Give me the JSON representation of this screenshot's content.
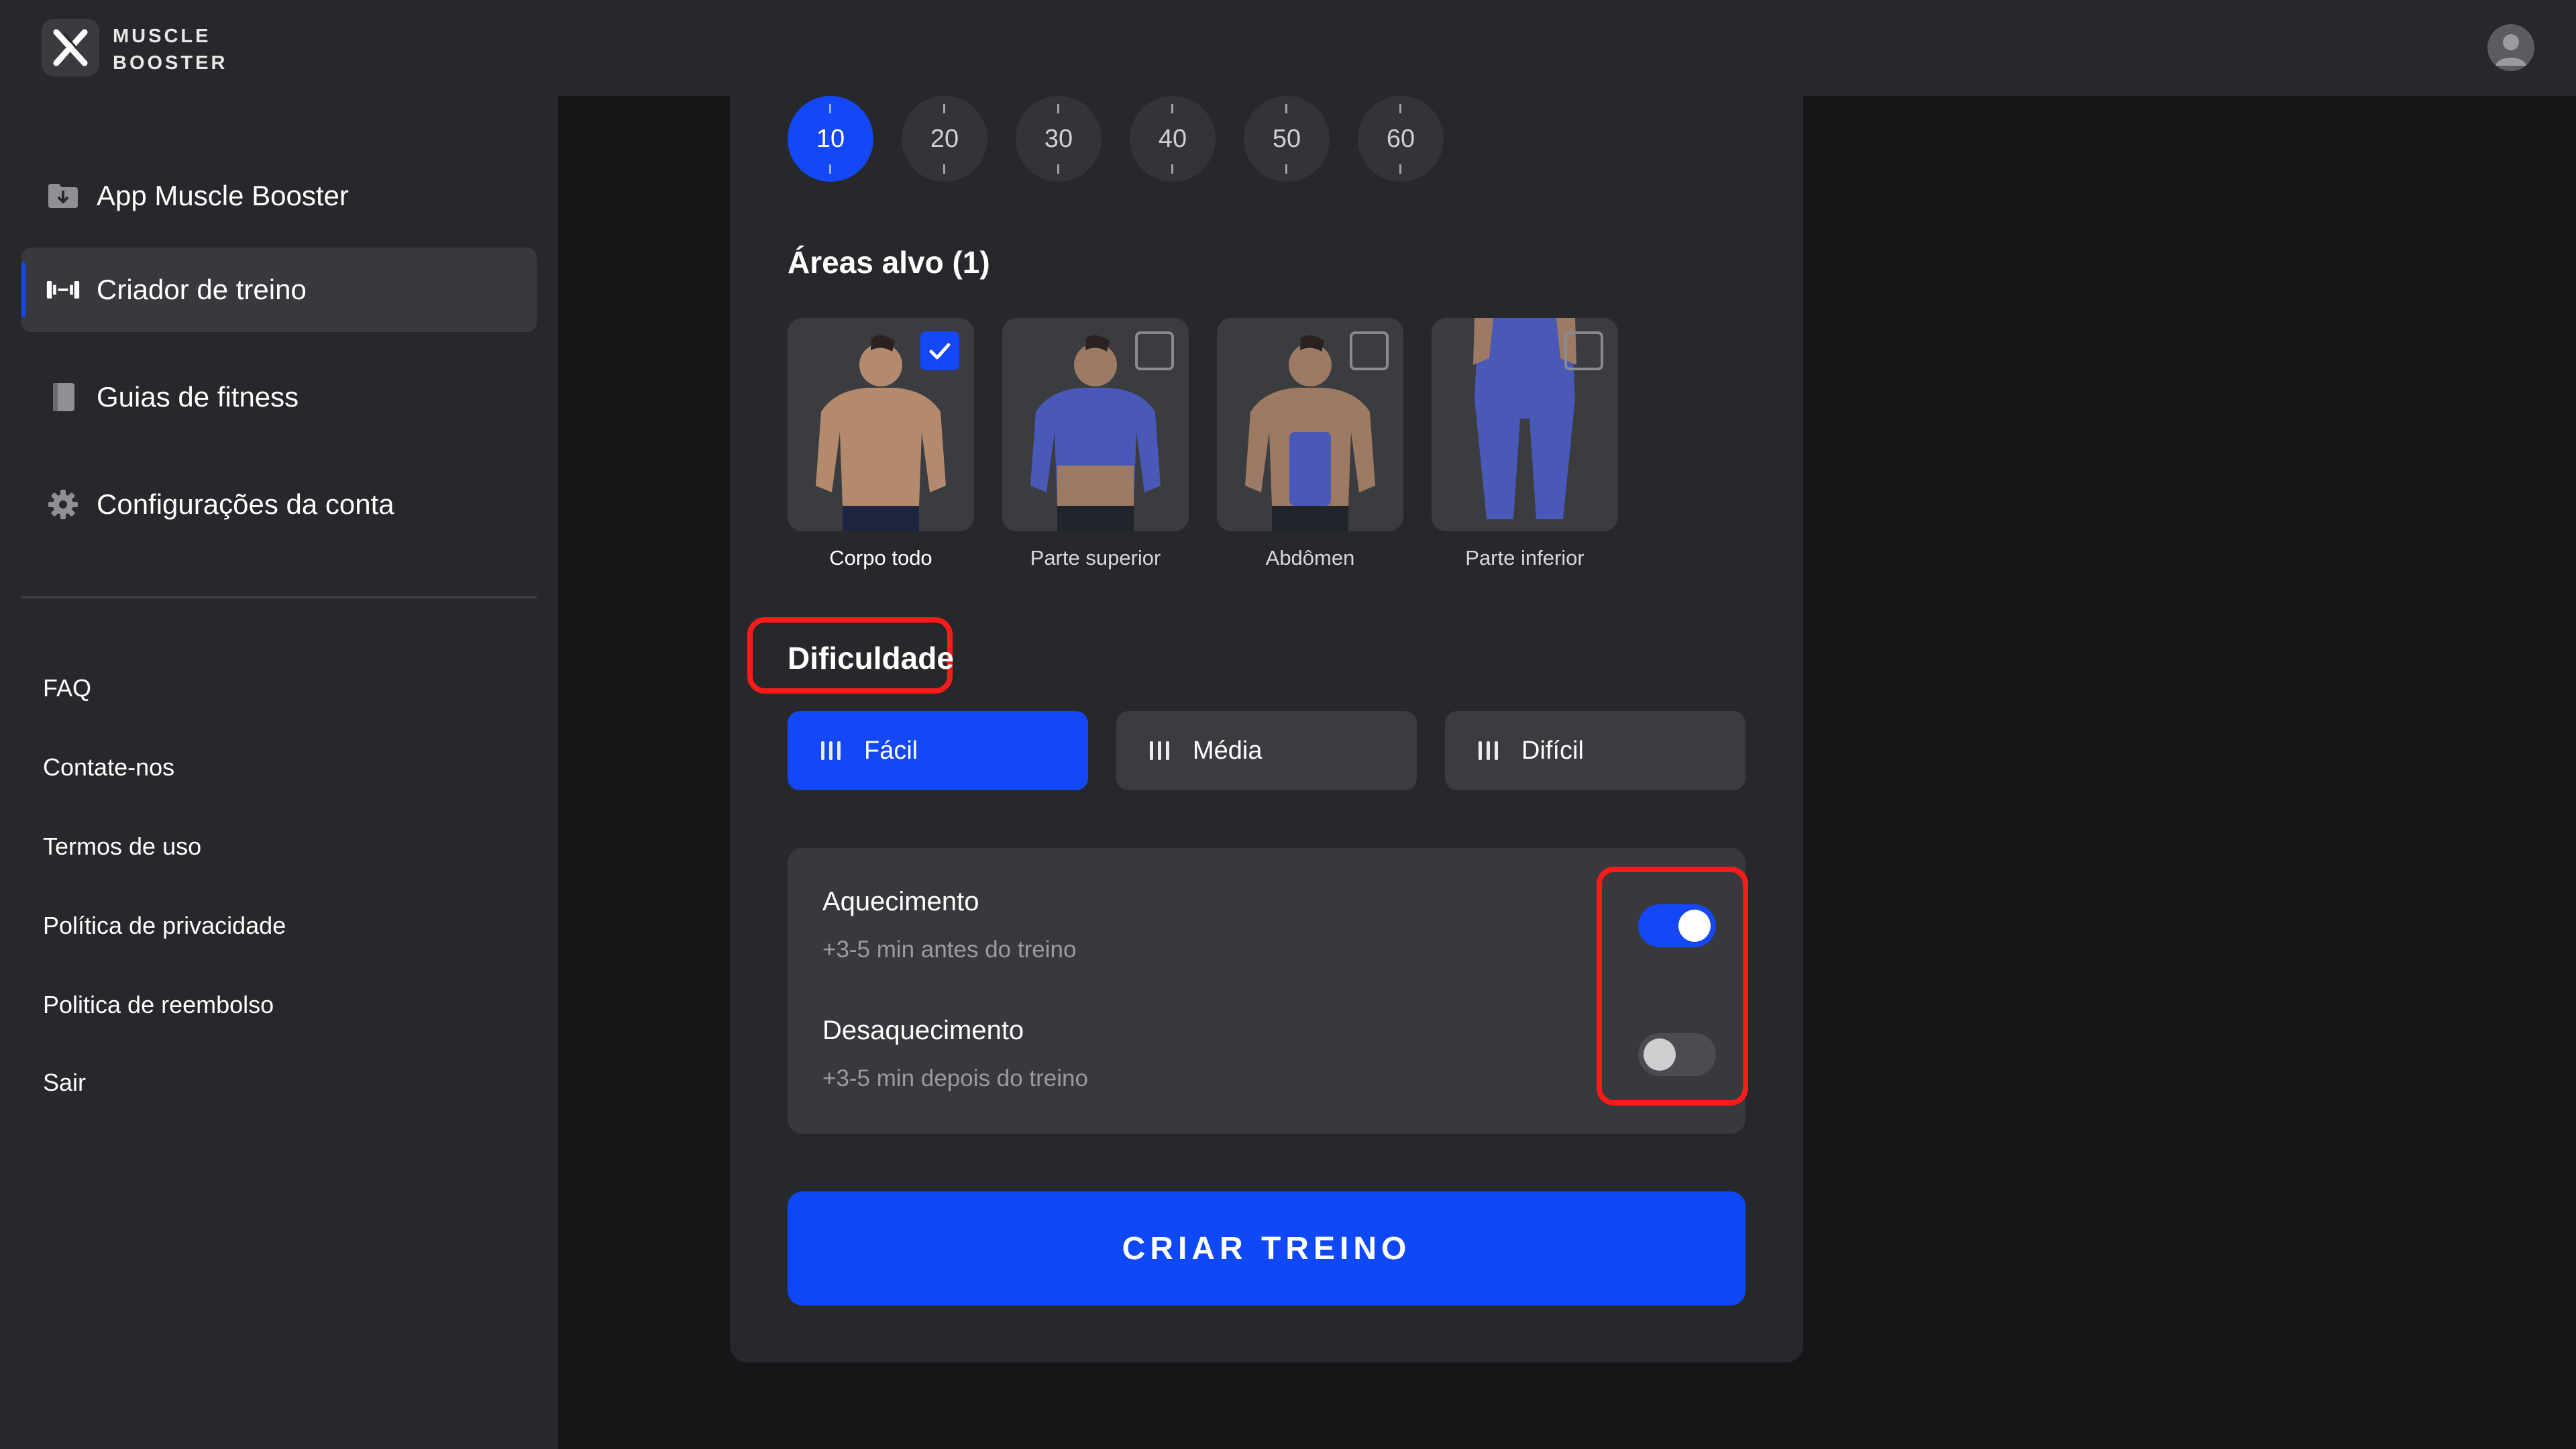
{
  "app": {
    "logo_line1": "MUSCLE",
    "logo_line2": "BOOSTER"
  },
  "sidebar": {
    "items": [
      {
        "label": "App Muscle Booster",
        "icon": "download-folder-icon",
        "active": false
      },
      {
        "label": "Criador de treino",
        "icon": "dumbbell-icon",
        "active": true
      },
      {
        "label": "Guias de fitness",
        "icon": "book-icon",
        "active": false
      },
      {
        "label": "Configurações da conta",
        "icon": "gear-icon",
        "active": false
      }
    ],
    "links": [
      "FAQ",
      "Contate-nos",
      "Termos de uso",
      "Política de privacidade",
      "Politica de reembolso",
      "Sair"
    ]
  },
  "durations": {
    "options": [
      "10",
      "20",
      "30",
      "40",
      "50",
      "60"
    ],
    "selected": "10"
  },
  "target_areas": {
    "title": "Áreas alvo (1)",
    "options": [
      {
        "label": "Corpo todo",
        "checked": true
      },
      {
        "label": "Parte superior",
        "checked": false
      },
      {
        "label": "Abdômen",
        "checked": false
      },
      {
        "label": "Parte inferior",
        "checked": false
      }
    ]
  },
  "difficulty": {
    "title": "Dificuldade",
    "options": [
      "Fácil",
      "Média",
      "Difícil"
    ],
    "selected": "Fácil"
  },
  "toggles": [
    {
      "title": "Aquecimento",
      "subtitle": "+3-5 min antes do treino",
      "on": true
    },
    {
      "title": "Desaquecimento",
      "subtitle": "+3-5 min depois do treino",
      "on": false
    }
  ],
  "create_button": "CRIAR TREINO",
  "colors": {
    "accent": "#1447f5",
    "highlight": "#ff1a1a",
    "background": "#151618",
    "panel": "#27282b"
  }
}
